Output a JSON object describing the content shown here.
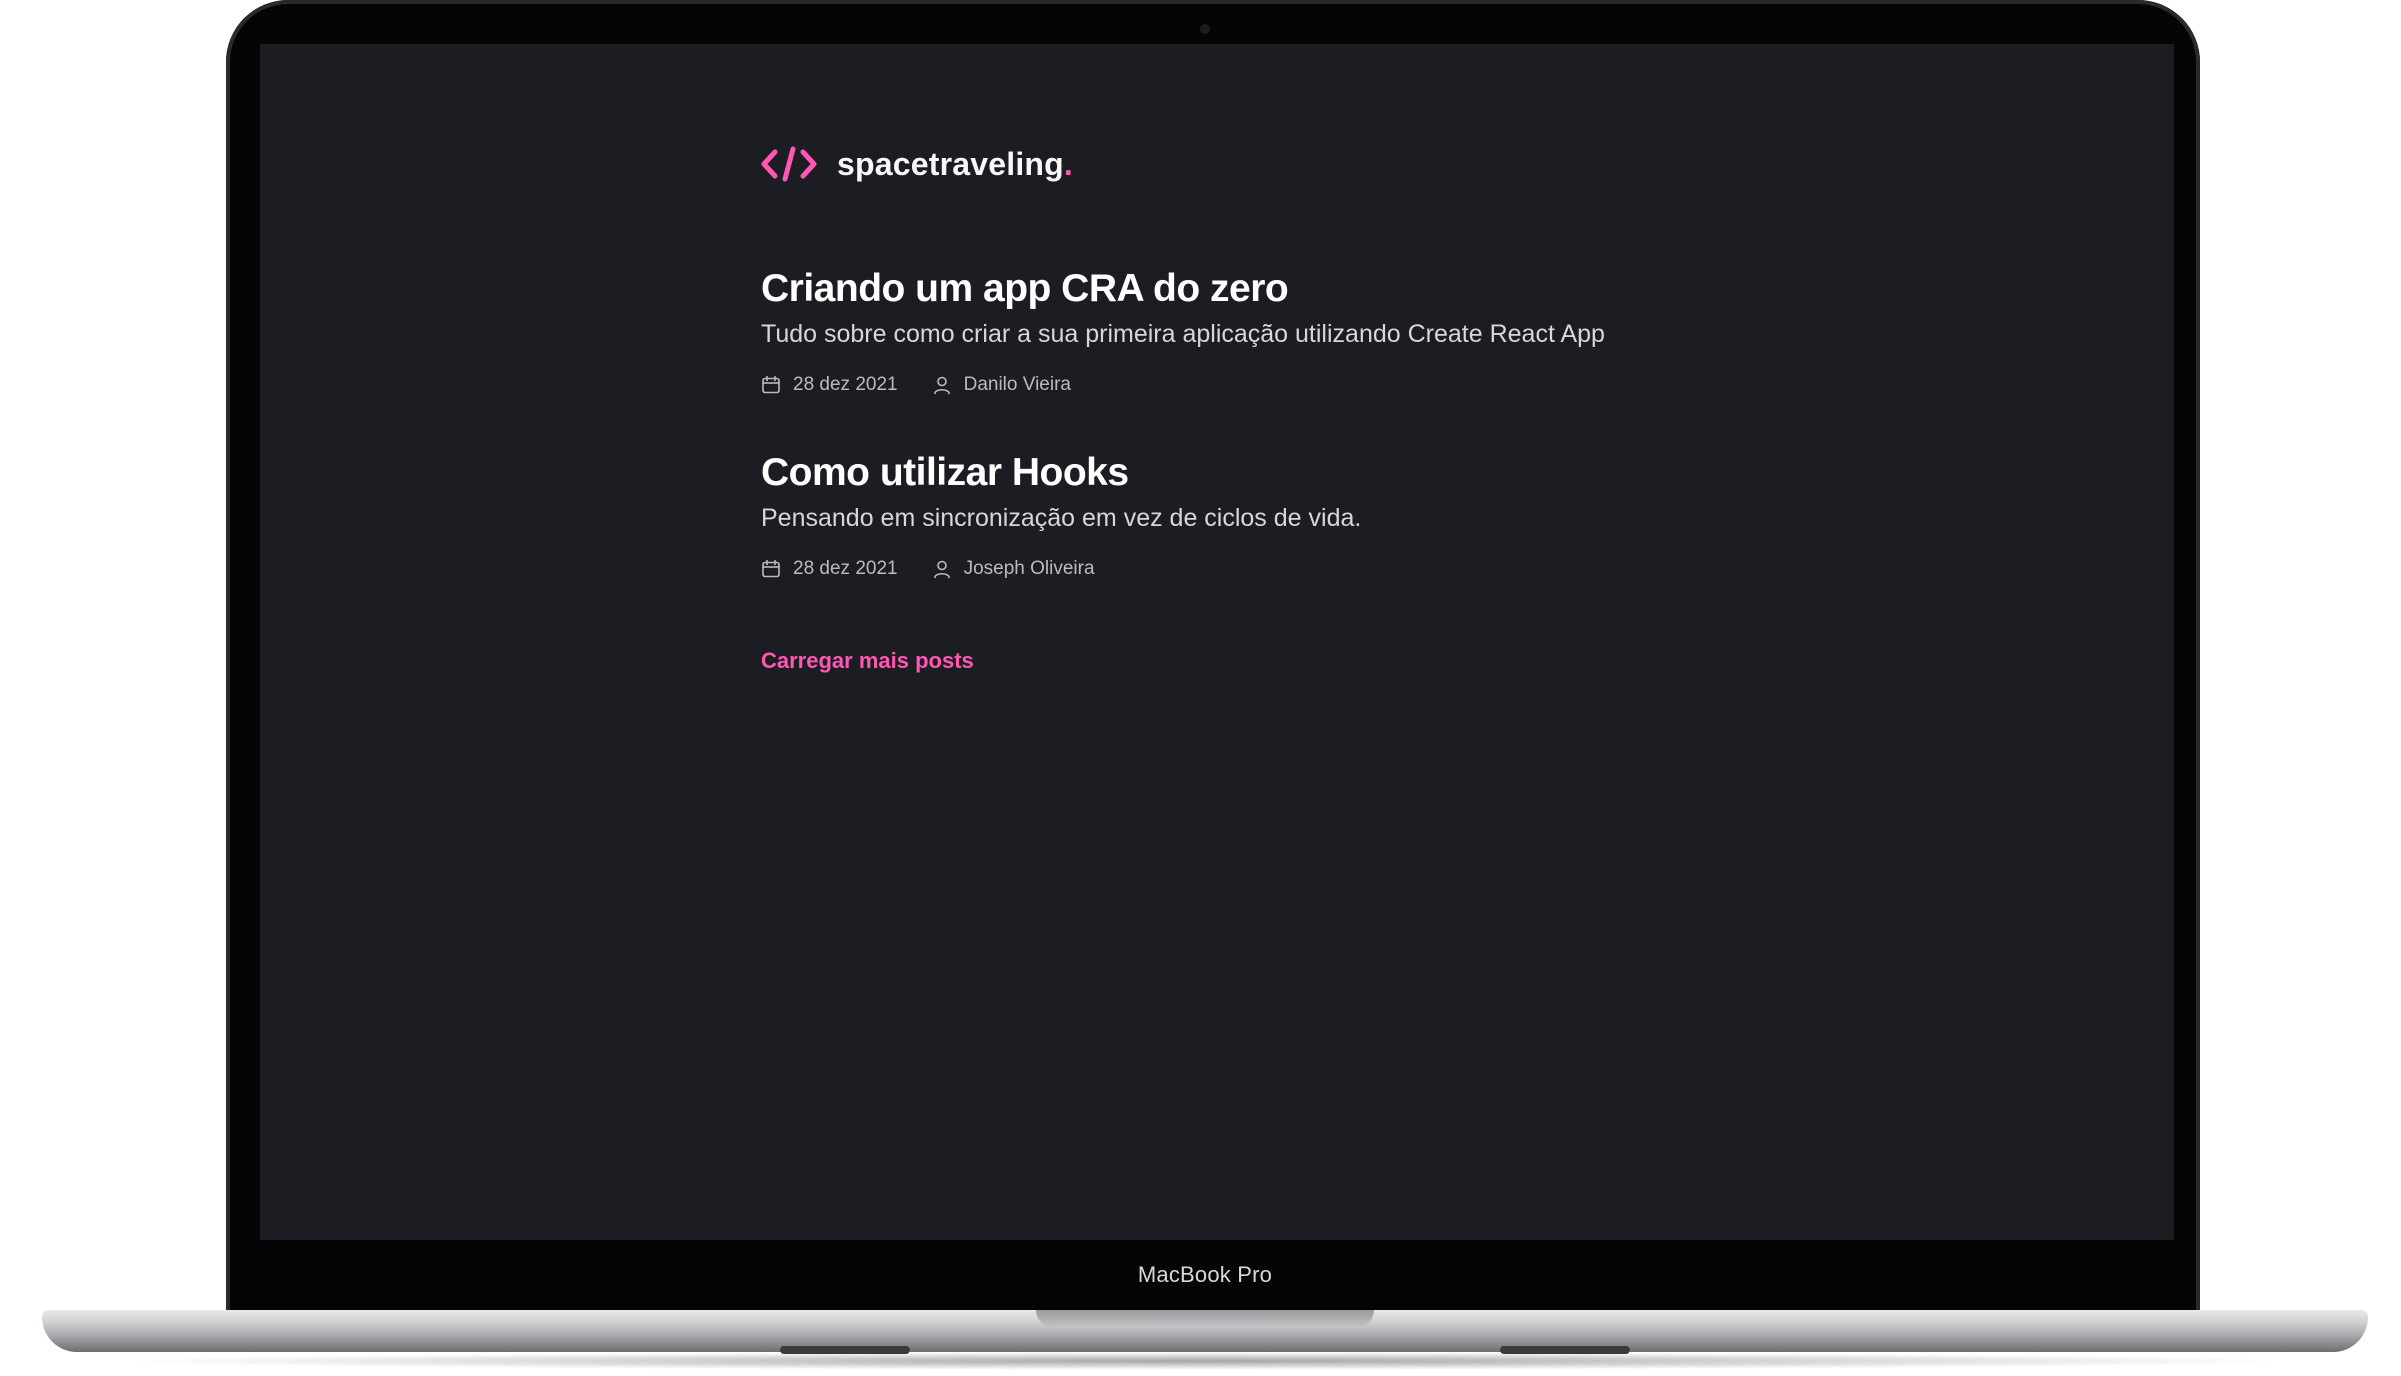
{
  "device": {
    "label": "MacBook Pro"
  },
  "header": {
    "logo_icon": "code-brackets-icon",
    "brand_name": "spacetraveling",
    "brand_dot": "."
  },
  "posts": [
    {
      "title": "Criando um app CRA do zero",
      "subtitle": "Tudo sobre como criar a sua primeira aplicação utilizando Create React App",
      "date": "28 dez 2021",
      "author": "Danilo Vieira"
    },
    {
      "title": "Como utilizar Hooks",
      "subtitle": "Pensando em sincronização em vez de ciclos de vida.",
      "date": "28 dez 2021",
      "author": "Joseph Oliveira"
    }
  ],
  "load_more_label": "Carregar mais posts",
  "colors": {
    "accent": "#ff57b2",
    "background": "#1b1d23",
    "heading": "#ffffff",
    "body_text": "#d7d7d7",
    "meta_text": "#bbbbbb"
  }
}
